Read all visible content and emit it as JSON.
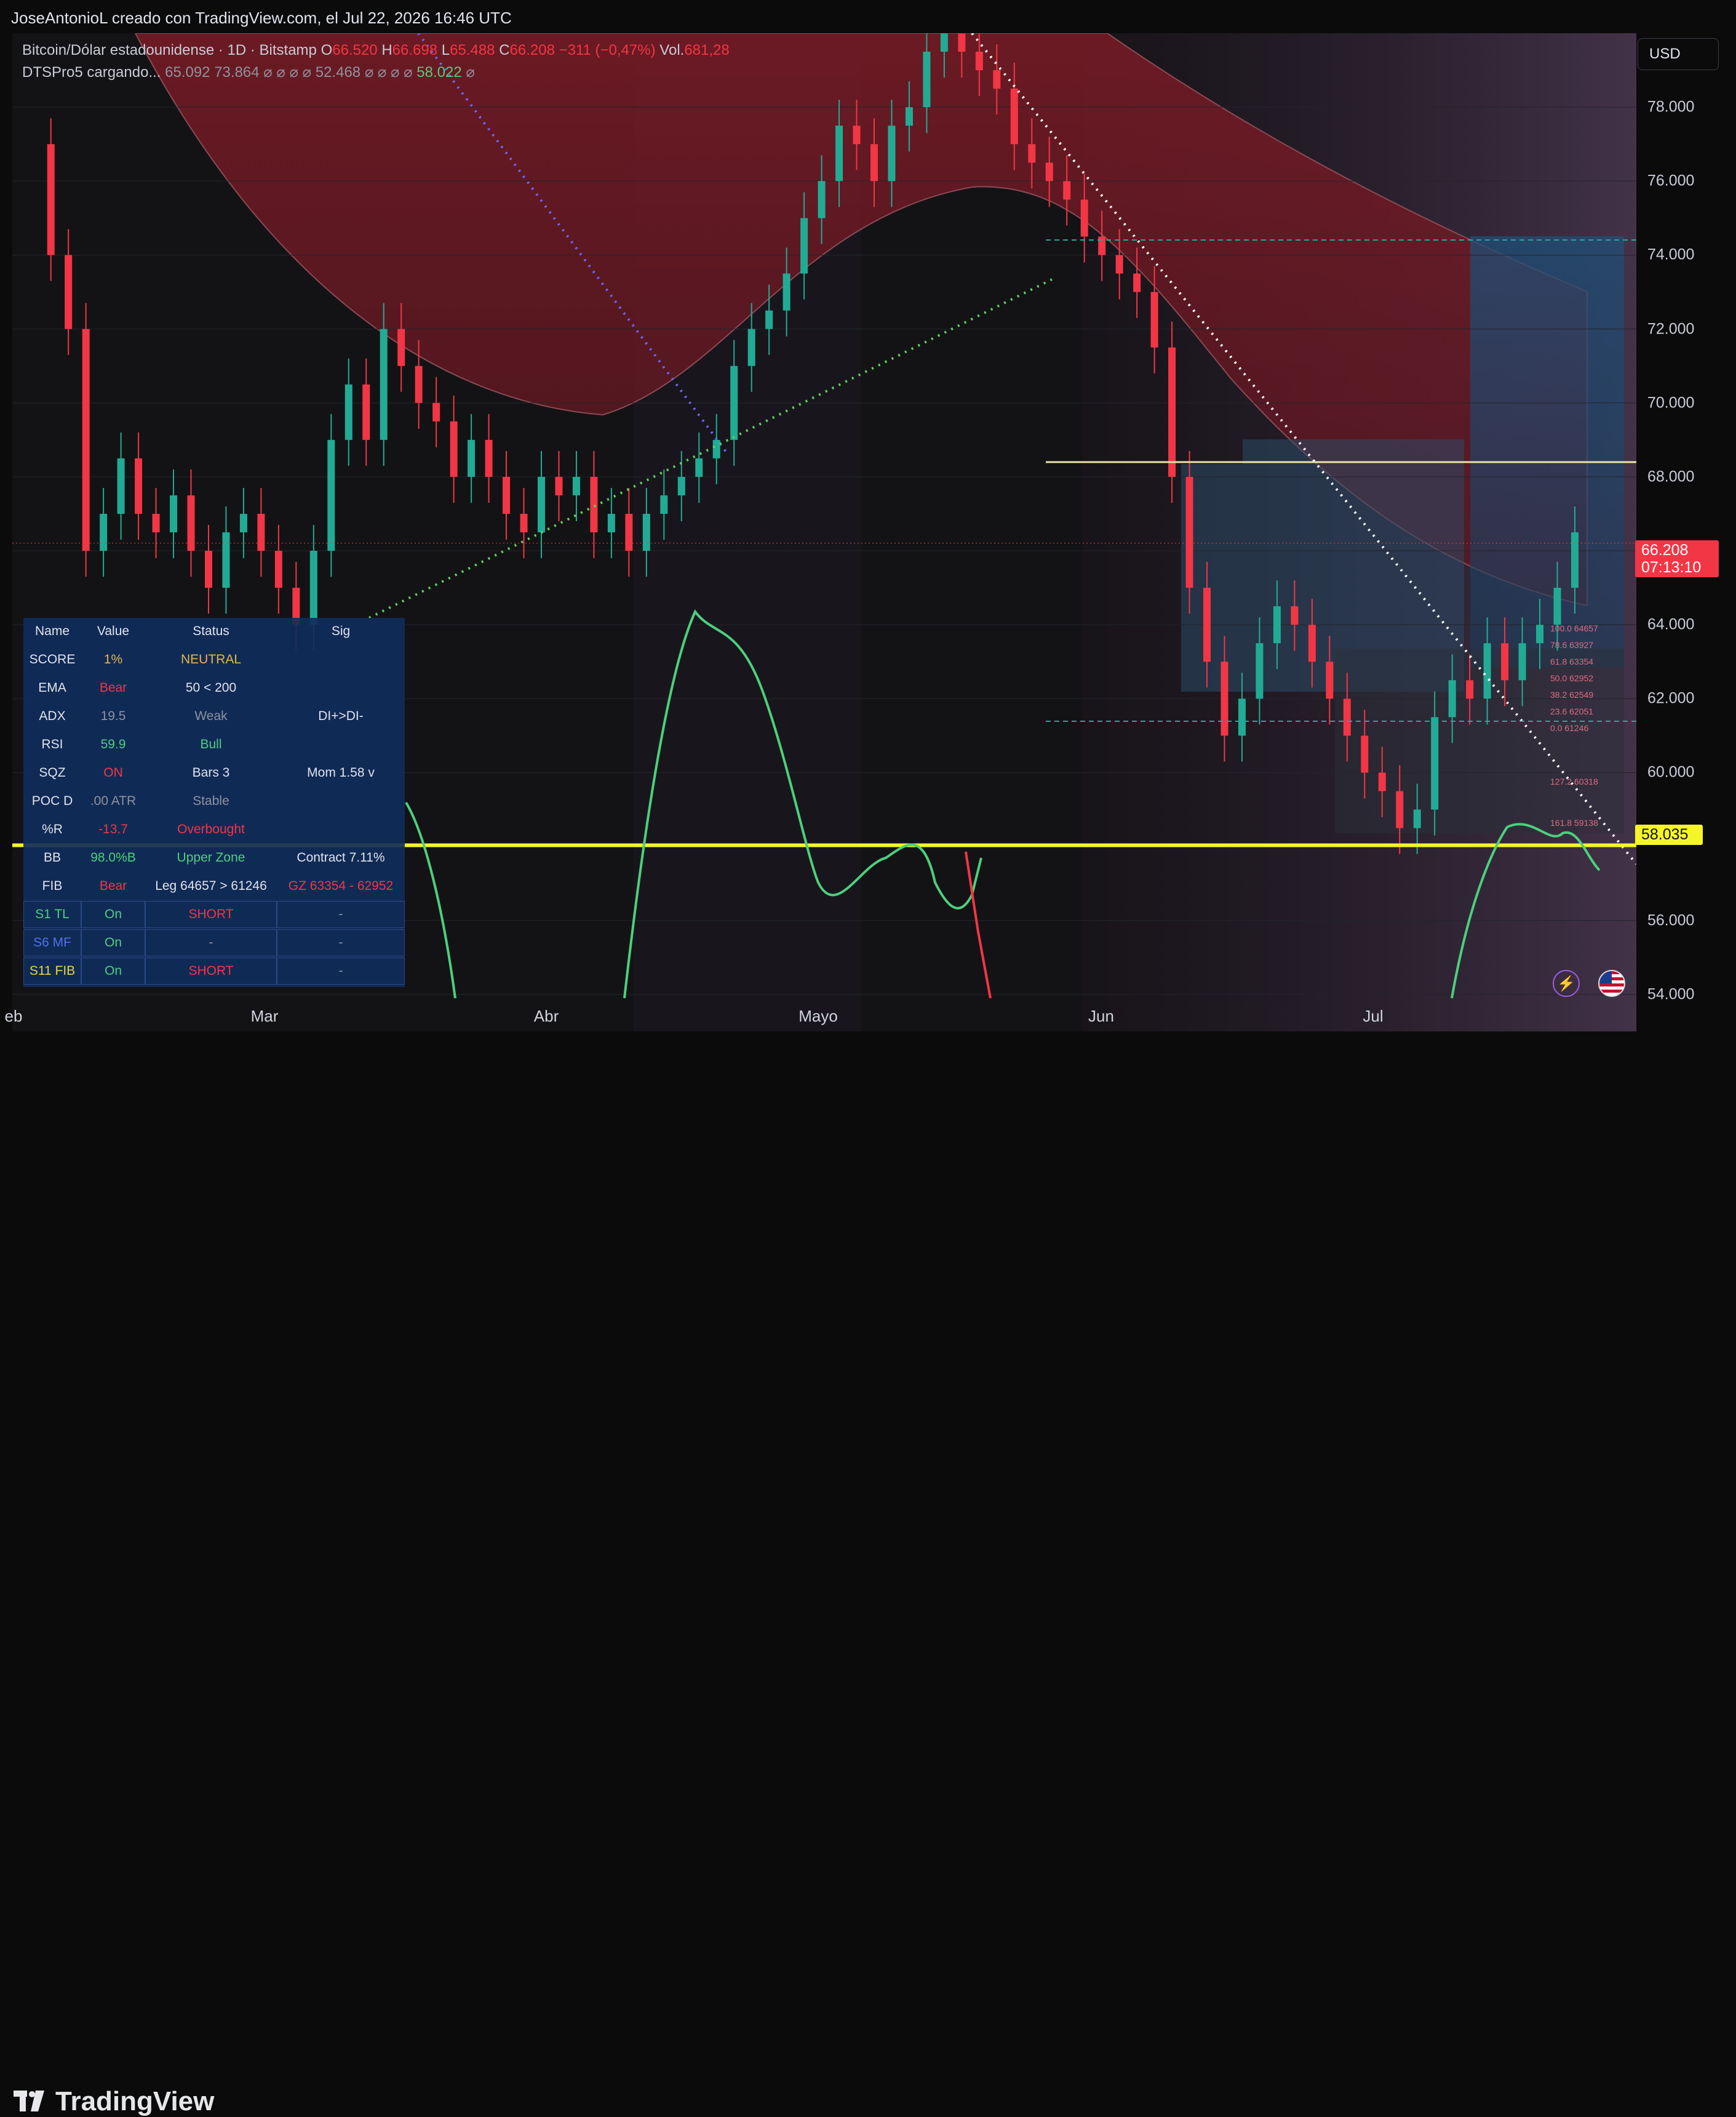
{
  "header": {
    "creator": "JoseAntonioL creado con TradingView.com, el Jul 22, 2026 16:46 UTC"
  },
  "legend": {
    "symbol": "Bitcoin/Dólar estadounidense · 1D · Bitstamp",
    "o_label": "O",
    "o_value": "66.520",
    "h_label": "H",
    "h_value": "66.698",
    "l_label": "L",
    "l_value": "65.488",
    "c_label": "C",
    "c_value": "66.208",
    "change": "−311 (−0,47%)",
    "vol_label": "Vol.",
    "vol_value": "681,28",
    "indicator": "DTSPro5 cargando...",
    "ind_values_a": "65.092  73.864  ⌀  ⌀  ⌀  ⌀  52.468  ⌀  ⌀  ⌀  ⌀",
    "ind_value_green": "58.022",
    "ind_tail": "⌀"
  },
  "currency": "USD",
  "price_badge": {
    "price": "66.208",
    "countdown": "07:13:10"
  },
  "level_badge": "58.035",
  "colors": {
    "up": "#22ab94",
    "down": "#f23645",
    "accent_yellow": "#f5f52a",
    "rsi": "#4cd07d"
  },
  "time_labels": [
    "eb",
    "Mar",
    "Abr",
    "Mayo",
    "Jun",
    "Jul"
  ],
  "fib_levels": [
    "100.0  64657",
    "78.6  63927",
    "61.8  63354",
    "50.0  62952",
    "38.2  62549",
    "23.6  62051",
    "0.0  61246",
    "127.2  60318",
    "161.8  59138"
  ],
  "table": {
    "headers": [
      "Name",
      "Value",
      "Status",
      "Sig"
    ],
    "rows": [
      [
        "SCORE",
        "1%",
        "NEUTRAL",
        ""
      ],
      [
        "EMA",
        "Bear",
        "50 < 200",
        ""
      ],
      [
        "ADX",
        "19.5",
        "Weak",
        "DI+>DI-"
      ],
      [
        "RSI",
        "59.9",
        "Bull",
        ""
      ],
      [
        "SQZ",
        "ON",
        "Bars 3",
        "Mom 1.58 v"
      ],
      [
        "POC D",
        ".00 ATR",
        "Stable",
        ""
      ],
      [
        "%R",
        "-13.7",
        "Overbought",
        ""
      ],
      [
        "BB",
        "98.0%B",
        "Upper Zone",
        "Contract 7.11%"
      ],
      [
        "FIB",
        "Bear",
        "Leg 64657 > 61246",
        "GZ 63354 - 62952"
      ],
      [
        "S1 TL",
        "On",
        "SHORT",
        "-"
      ],
      [
        "S6 MF",
        "On",
        "-",
        "-"
      ],
      [
        "S11 FIB",
        "On",
        "SHORT",
        "-"
      ]
    ]
  },
  "footer": {
    "brand": "TradingView"
  },
  "chart_data": {
    "type": "candlestick",
    "title": "Bitcoin/Dólar estadounidense · 1D · Bitstamp",
    "y_ticks": [
      54000,
      56000,
      58000,
      60000,
      62000,
      64000,
      66000,
      68000,
      70000,
      72000,
      74000,
      76000,
      78000
    ],
    "y_tick_labels": [
      "54.000",
      "56.000",
      "60.000",
      "62.000",
      "64.000",
      "68.000",
      "70.000",
      "72.000",
      "74.000",
      "76.000",
      "78.000"
    ],
    "ylim": [
      53000,
      80000
    ],
    "x_labels": [
      "eb",
      "Mar",
      "Abr",
      "Mayo",
      "Jun",
      "Jul"
    ],
    "grid": true,
    "horizontal_levels": {
      "support": 58035,
      "resistance": 68400,
      "last": 66208
    },
    "close_path": [
      [
        0,
        77000
      ],
      [
        3,
        74000
      ],
      [
        5,
        72000
      ],
      [
        7,
        66000
      ],
      [
        9,
        67000
      ],
      [
        11,
        68500
      ],
      [
        13,
        67000
      ],
      [
        15,
        66500
      ],
      [
        17,
        67500
      ],
      [
        19,
        66000
      ],
      [
        21,
        65000
      ],
      [
        23,
        66500
      ],
      [
        25,
        67000
      ],
      [
        27,
        66000
      ],
      [
        29,
        65000
      ],
      [
        31,
        64000
      ],
      [
        33,
        66000
      ],
      [
        35,
        69000
      ],
      [
        37,
        70500
      ],
      [
        39,
        69000
      ],
      [
        41,
        72000
      ],
      [
        43,
        71000
      ],
      [
        45,
        70000
      ],
      [
        47,
        69500
      ],
      [
        49,
        68000
      ],
      [
        51,
        69000
      ],
      [
        53,
        68000
      ],
      [
        55,
        67000
      ],
      [
        57,
        66500
      ],
      [
        59,
        68000
      ],
      [
        61,
        67500
      ],
      [
        63,
        68000
      ],
      [
        65,
        66500
      ],
      [
        67,
        67000
      ],
      [
        69,
        66000
      ],
      [
        71,
        67000
      ],
      [
        73,
        67500
      ],
      [
        75,
        68000
      ],
      [
        77,
        68500
      ],
      [
        79,
        69000
      ],
      [
        81,
        71000
      ],
      [
        83,
        72000
      ],
      [
        85,
        72500
      ],
      [
        87,
        73500
      ],
      [
        89,
        75000
      ],
      [
        91,
        76000
      ],
      [
        93,
        77500
      ],
      [
        95,
        77000
      ],
      [
        97,
        76000
      ],
      [
        99,
        77500
      ],
      [
        101,
        78000
      ],
      [
        103,
        79500
      ],
      [
        105,
        80000
      ],
      [
        107,
        79500
      ],
      [
        109,
        79000
      ],
      [
        111,
        78500
      ],
      [
        113,
        77000
      ],
      [
        115,
        76500
      ],
      [
        117,
        76000
      ],
      [
        119,
        75500
      ],
      [
        121,
        74500
      ],
      [
        123,
        74000
      ],
      [
        125,
        73500
      ],
      [
        127,
        73000
      ],
      [
        129,
        71500
      ],
      [
        131,
        68000
      ],
      [
        133,
        65000
      ],
      [
        135,
        63000
      ],
      [
        137,
        61000
      ],
      [
        139,
        62000
      ],
      [
        141,
        63500
      ],
      [
        143,
        64500
      ],
      [
        145,
        64000
      ],
      [
        147,
        63000
      ],
      [
        149,
        62000
      ],
      [
        151,
        61000
      ],
      [
        153,
        60000
      ],
      [
        155,
        59500
      ],
      [
        157,
        58500
      ],
      [
        159,
        59000
      ],
      [
        161,
        61500
      ],
      [
        163,
        62500
      ],
      [
        165,
        62000
      ],
      [
        167,
        63500
      ],
      [
        169,
        62500
      ],
      [
        171,
        63500
      ],
      [
        173,
        64000
      ],
      [
        175,
        65000
      ],
      [
        177,
        66500
      ]
    ]
  }
}
